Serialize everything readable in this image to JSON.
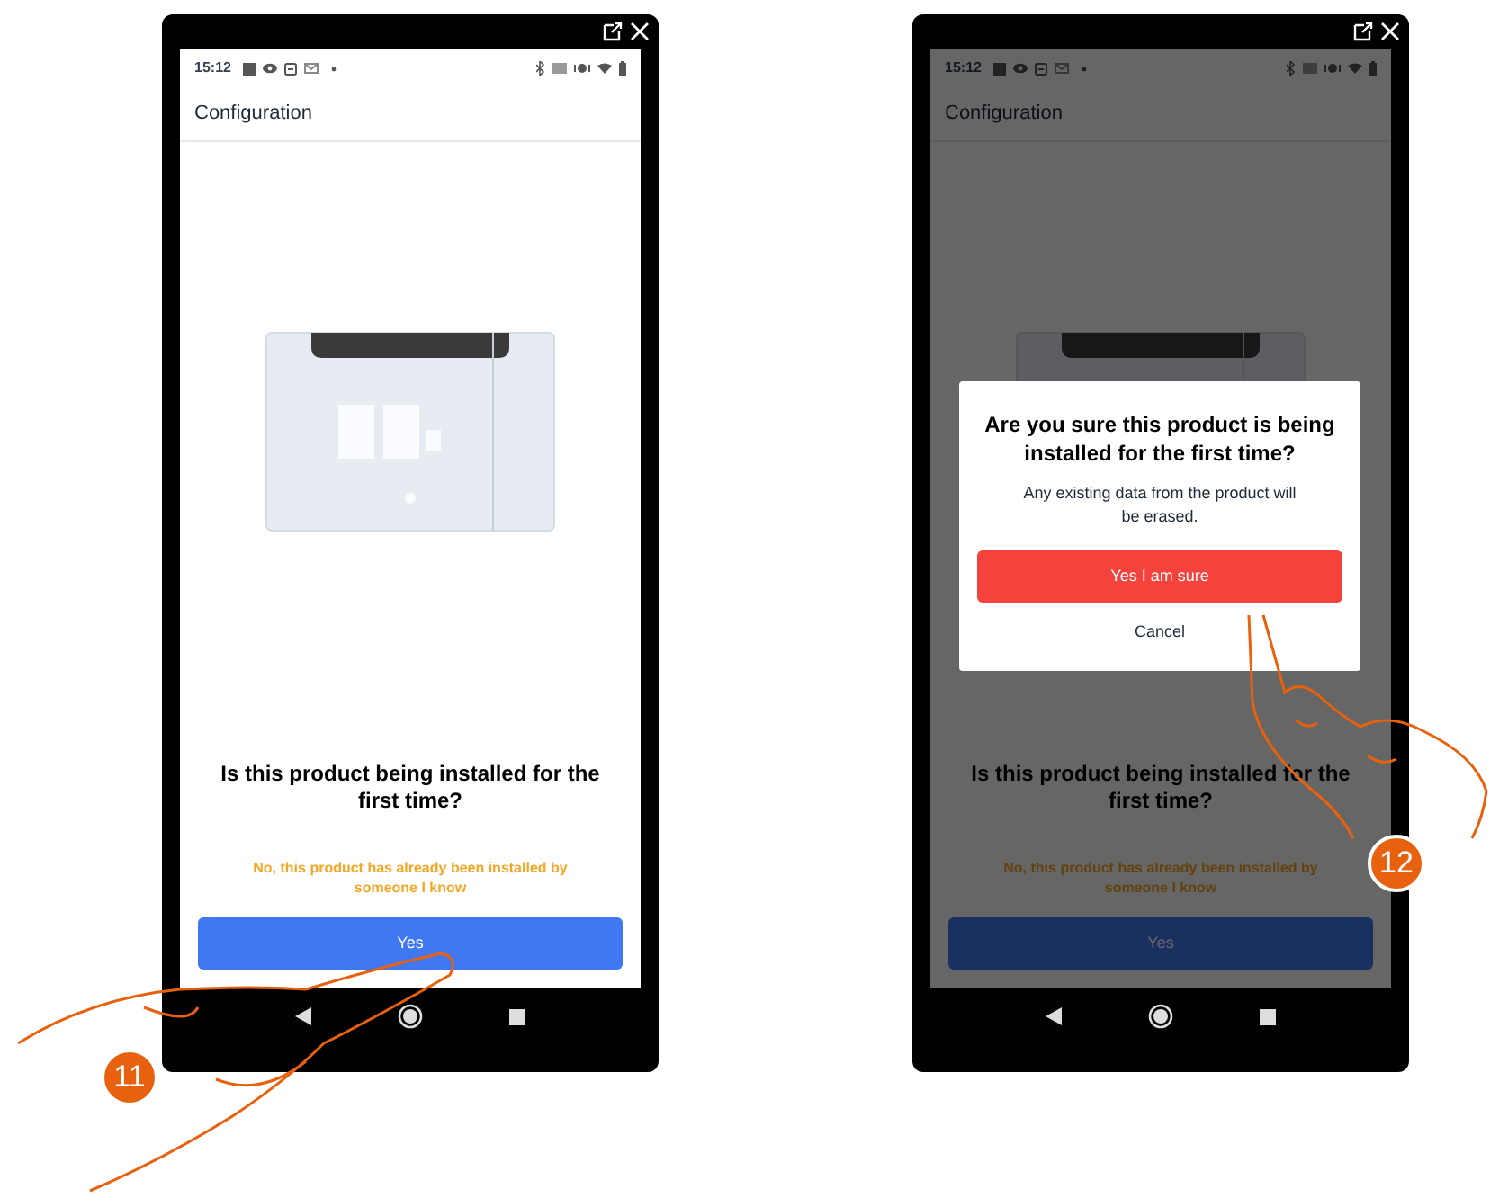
{
  "phones": [
    {
      "dimmed": false,
      "status_time": "15:12",
      "title": "Configuration",
      "question": "Is this product being installed for the first time?",
      "link": "No, this product has already been installed by someone I know",
      "button": "Yes",
      "step": "11"
    },
    {
      "dimmed": true,
      "status_time": "15:12",
      "title": "Configuration",
      "question": "Is this product being installed for the first time?",
      "link": "No, this product has already been installed by someone I know",
      "button": "Yes",
      "step": "12",
      "dialog": {
        "title": "Are you sure this product is being installed for the first time?",
        "message": "Any existing data from the product will be erased.",
        "buttons": [
          {
            "label": "Yes I am sure",
            "kind": "primary"
          },
          {
            "label": "Cancel",
            "kind": "text"
          }
        ]
      }
    }
  ]
}
